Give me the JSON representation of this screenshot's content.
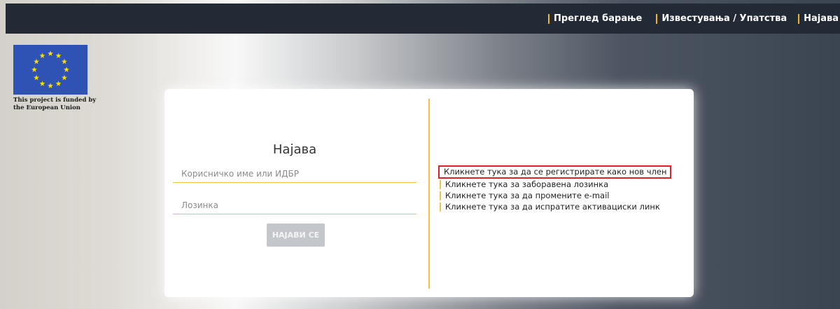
{
  "nav": {
    "items": [
      {
        "label": "Преглед барање"
      },
      {
        "label": "Известувања / Упатства"
      },
      {
        "label": "Најава"
      }
    ]
  },
  "eu": {
    "caption_line1": "This project is funded by",
    "caption_line2": "the European Union",
    "flag_color": "#2f52b5",
    "star_color": "#ffdd00"
  },
  "login": {
    "title": "Најава",
    "username_placeholder": "Корисничко име или ИДБР",
    "username_value": "",
    "password_placeholder": "Лозинка",
    "password_value": "",
    "button_label": "НАЈАВИ СЕ"
  },
  "links": [
    {
      "label": "Кликнете тука за да се регистрирате како нов член",
      "highlighted": true
    },
    {
      "label": "Кликнете тука за заборавена лозинка"
    },
    {
      "label": "Кликнете тука за да промените e-mail"
    },
    {
      "label": "Кликнете тука за да испратите активациски линк"
    }
  ],
  "colors": {
    "topbar": "#222a35",
    "accent": "#f0c24a",
    "highlight_border": "#e0202a"
  }
}
